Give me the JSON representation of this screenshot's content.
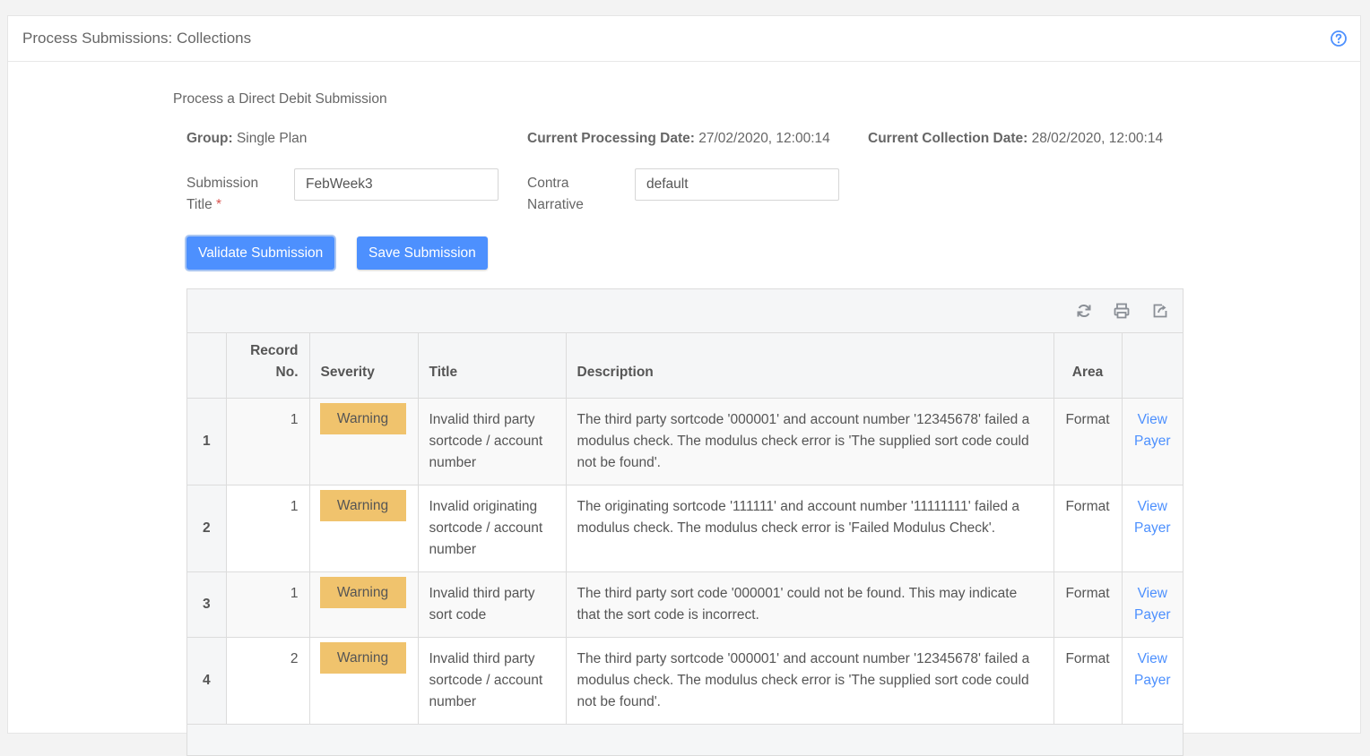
{
  "header": {
    "title": "Process Submissions: Collections",
    "help_icon": "help-circle-icon"
  },
  "subtitle": "Process a Direct Debit Submission",
  "info": {
    "group_label": "Group:",
    "group_value": "Single Plan",
    "processing_label": "Current Processing Date:",
    "processing_value": "27/02/2020, 12:00:14",
    "collection_label": "Current Collection Date:",
    "collection_value": "28/02/2020, 12:00:14"
  },
  "form": {
    "title_label_line1": "Submission",
    "title_label_line2": "Title",
    "required_mark": "*",
    "title_value": "FebWeek3",
    "contra_label_line1": "Contra",
    "contra_label_line2": "Narrative",
    "contra_value": "default"
  },
  "buttons": {
    "validate": "Validate Submission",
    "save": "Save Submission"
  },
  "toolbar": {
    "icons": [
      "refresh-icon",
      "print-icon",
      "export-icon"
    ]
  },
  "table": {
    "columns": [
      "",
      "Record No.",
      "Severity",
      "Title",
      "Description",
      "Area",
      ""
    ],
    "record_no_line1": "Record",
    "record_no_line2": "No.",
    "rows": [
      {
        "index": "1",
        "record_no": "1",
        "severity": "Warning",
        "title": "Invalid third party sortcode / account number",
        "description": "The third party sortcode '000001' and account number '12345678' failed a modulus check. The modulus check error is 'The supplied sort code could not be found'.",
        "area": "Format",
        "action_line1": "View",
        "action_line2": "Payer"
      },
      {
        "index": "2",
        "record_no": "1",
        "severity": "Warning",
        "title": "Invalid originating sortcode / account number",
        "description": "The originating sortcode '111111' and account number '11111111' failed a modulus check. The modulus check error is 'Failed Modulus Check'.",
        "area": "Format",
        "action_line1": "View",
        "action_line2": "Payer"
      },
      {
        "index": "3",
        "record_no": "1",
        "severity": "Warning",
        "title": "Invalid third party sort code",
        "description": "The third party sort code '000001' could not be found. This may indicate that the sort code is incorrect.",
        "area": "Format",
        "action_line1": "View",
        "action_line2": "Payer"
      },
      {
        "index": "4",
        "record_no": "2",
        "severity": "Warning",
        "title": "Invalid third party sortcode / account number",
        "description": "The third party sortcode '000001' and account number '12345678' failed a modulus check. The modulus check error is 'The supplied sort code could not be found'.",
        "area": "Format",
        "action_line1": "View",
        "action_line2": "Payer"
      }
    ]
  },
  "colors": {
    "accent": "#4d90fe",
    "warning": "#f0c36d",
    "required": "#d9534f"
  }
}
